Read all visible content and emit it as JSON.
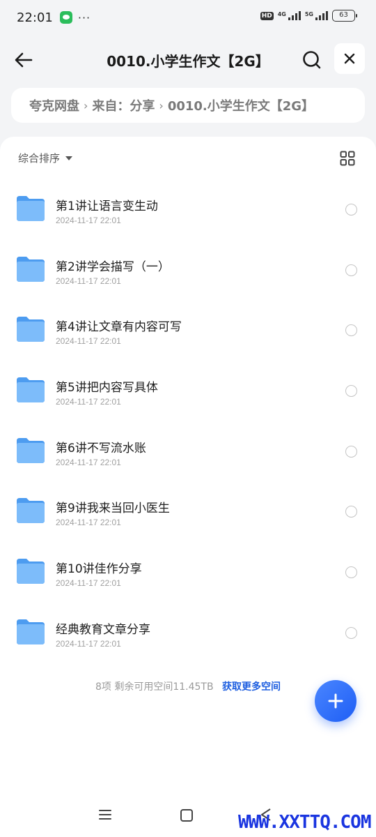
{
  "status_bar": {
    "time": "22:01",
    "dots": "···",
    "hd": "HD",
    "net1": "4G",
    "net2": "5G",
    "battery": "63"
  },
  "header": {
    "title": "0010.小学生作文【2G】"
  },
  "breadcrumb": {
    "items": [
      "夸克网盘",
      "来自：分享",
      "0010.小学生作文【2G】"
    ],
    "separator": "›"
  },
  "toolbar": {
    "sort_label": "综合排序"
  },
  "files": [
    {
      "name": "第1讲让语言变生动",
      "date": "2024-11-17 22:01"
    },
    {
      "name": "第2讲学会描写（一）",
      "date": "2024-11-17 22:01"
    },
    {
      "name": "第4讲让文章有内容可写",
      "date": "2024-11-17 22:01"
    },
    {
      "name": "第5讲把内容写具体",
      "date": "2024-11-17 22:01"
    },
    {
      "name": "第6讲不写流水账",
      "date": "2024-11-17 22:01"
    },
    {
      "name": "第9讲我来当回小医生",
      "date": "2024-11-17 22:01"
    },
    {
      "name": "第10讲佳作分享",
      "date": "2024-11-17 22:01"
    },
    {
      "name": "经典教育文章分享",
      "date": "2024-11-17 22:01"
    }
  ],
  "footer": {
    "info": "8项  剩余可用空间11.45TB",
    "link": "获取更多空间"
  },
  "watermark": "WWW.XXTTQ.COM",
  "colors": {
    "accent": "#1f5fe0",
    "folder": "#5aa9f5",
    "background": "#f3f4f6"
  }
}
